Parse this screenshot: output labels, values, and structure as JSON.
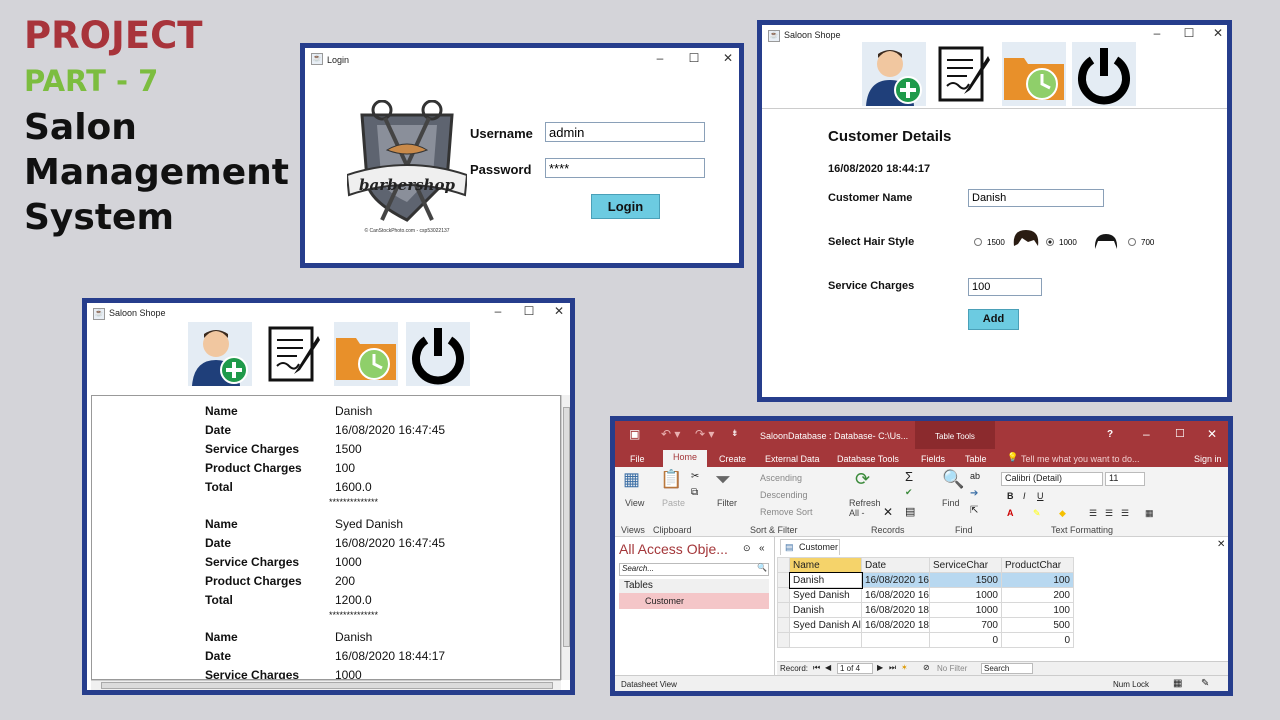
{
  "heading": {
    "project": "PROJECT",
    "part": "PART - 7",
    "title": "Salon Management System"
  },
  "login": {
    "title": "Login",
    "username_label": "Username",
    "username_value": "admin",
    "password_label": "Password",
    "password_value": "****",
    "login_button": "Login",
    "logo_text": "barbershop",
    "copyright": "© CanStockPhoto.com - csp53022137"
  },
  "saloon_right": {
    "title": "Saloon Shope",
    "heading": "Customer Details",
    "datetime": "16/08/2020 18:44:17",
    "name_label": "Customer Name",
    "name_value": "Danish",
    "hair_label": "Select Hair Style",
    "opt1": "1500",
    "opt2": "1000",
    "opt3": "700",
    "charges_label": "Service Charges",
    "charges_value": "100",
    "add_button": "Add"
  },
  "saloon_left": {
    "title": "Saloon Shope",
    "records": [
      {
        "name": "Danish",
        "date": "16/08/2020 16:47:45",
        "service": "1500",
        "product": "100",
        "total": "1600.0"
      },
      {
        "name": "Syed Danish",
        "date": "16/08/2020 16:47:45",
        "service": "1000",
        "product": "200",
        "total": "1200.0"
      },
      {
        "name": "Danish",
        "date": "16/08/2020 18:44:17",
        "service": "1000",
        "product": "",
        "total": ""
      }
    ],
    "labels": {
      "name": "Name",
      "date": "Date",
      "service": "Service Charges",
      "product": "Product Charges",
      "total": "Total"
    },
    "sep": "**************"
  },
  "access": {
    "title": "SaloonDatabase : Database- C:\\Us...",
    "table_tools": "Table Tools",
    "help": "?",
    "tabs": [
      "File",
      "Home",
      "Create",
      "External Data",
      "Database Tools",
      "Fields",
      "Table"
    ],
    "tell_me": "Tell me what you want to do...",
    "sign_in": "Sign in",
    "ribbon": {
      "view": "View",
      "paste": "Paste",
      "filter": "Filter",
      "ascending": "Ascending",
      "descending": "Descending",
      "remove_sort": "Remove Sort",
      "refresh": "Refresh All -",
      "find": "Find",
      "font": "Calibri (Detail)",
      "size": "11",
      "groups": [
        "Views",
        "Clipboard",
        "Sort & Filter",
        "Records",
        "Find",
        "Text Formatting"
      ]
    },
    "nav": {
      "title": "All Access Obje...",
      "search": "Search...",
      "section": "Tables",
      "item": "Customer"
    },
    "table_tab": "Customer",
    "columns": [
      "Name",
      "Date",
      "ServiceChar",
      "ProductChar"
    ],
    "rows": [
      [
        "Danish",
        "16/08/2020 16",
        "1500",
        "100"
      ],
      [
        "Syed Danish",
        "16/08/2020 16",
        "1000",
        "200"
      ],
      [
        "Danish",
        "16/08/2020 18",
        "1000",
        "100"
      ],
      [
        "Syed Danish Al",
        "16/08/2020 18",
        "700",
        "500"
      ],
      [
        "",
        "",
        "0",
        "0"
      ]
    ],
    "record_label": "Record:",
    "record_pos": "1 of 4",
    "no_filter": "No Filter",
    "search": "Search",
    "status": "Datasheet View",
    "numlock": "Num Lock"
  }
}
